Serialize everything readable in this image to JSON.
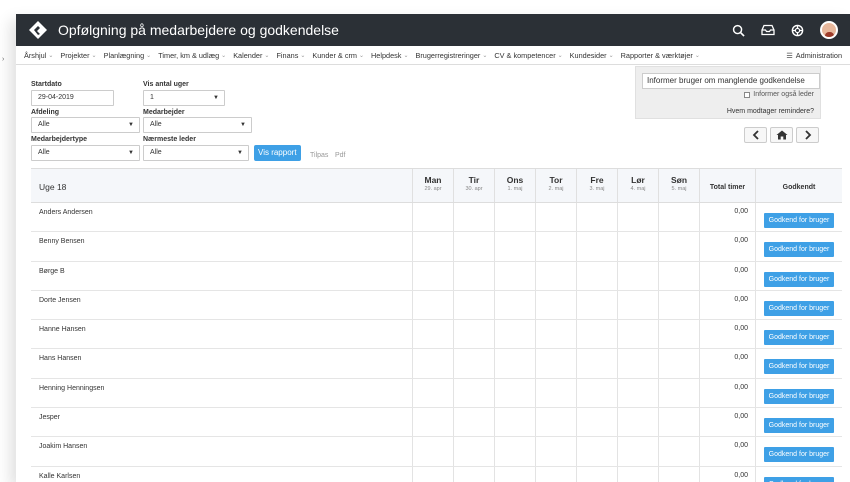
{
  "header": {
    "title": "Opfølgning på medarbejdere og godkendelse"
  },
  "nav": {
    "items": [
      {
        "label": "Årshjul"
      },
      {
        "label": "Projekter"
      },
      {
        "label": "Planlægning"
      },
      {
        "label": "Timer, km & udlæg"
      },
      {
        "label": "Kalender"
      },
      {
        "label": "Finans"
      },
      {
        "label": "Kunder & crm"
      },
      {
        "label": "Helpdesk"
      },
      {
        "label": "Brugerregistreringer"
      },
      {
        "label": "CV & kompetencer"
      },
      {
        "label": "Kundesider"
      },
      {
        "label": "Rapporter & værktøjer"
      }
    ],
    "admin": "Administration"
  },
  "filters": {
    "startdato_label": "Startdato",
    "startdato_value": "29-04-2019",
    "vis_antal_uger_label": "Vis antal uger",
    "vis_antal_uger_value": "1",
    "afdeling_label": "Afdeling",
    "afdeling_value": "Alle",
    "medarbejder_label": "Medarbejder",
    "medarbejder_value": "Alle",
    "medarbejdertype_label": "Medarbejdertype",
    "medarbejdertype_value": "Alle",
    "naermeste_leder_label": "Nærmeste leder",
    "naermeste_leder_value": "Alle",
    "vis_rapport": "Vis rapport",
    "tilpas": "Tilpas",
    "pdf": "Pdf"
  },
  "reminder": {
    "button": "Informer bruger om manglende godkendelse",
    "also_leader": "Informer også leder",
    "who_link": "Hvem modtager remindere?"
  },
  "grid": {
    "week": "Uge 18",
    "days": [
      {
        "name": "Man",
        "date": "29. apr"
      },
      {
        "name": "Tir",
        "date": "30. apr"
      },
      {
        "name": "Ons",
        "date": "1. maj"
      },
      {
        "name": "Tor",
        "date": "2. maj"
      },
      {
        "name": "Fre",
        "date": "3. maj"
      },
      {
        "name": "Lør",
        "date": "4. maj"
      },
      {
        "name": "Søn",
        "date": "5. maj"
      }
    ],
    "total_header": "Total timer",
    "approved_header": "Godkendt",
    "approve_label": "Godkend for bruger",
    "rows": [
      {
        "name": "Anders Andersen",
        "total": "0,00"
      },
      {
        "name": "Benny Bensen",
        "total": "0,00"
      },
      {
        "name": "Børge B",
        "total": "0,00"
      },
      {
        "name": "Dorte Jensen",
        "total": "0,00"
      },
      {
        "name": "Hanne Hansen",
        "total": "0,00"
      },
      {
        "name": "Hans Hansen",
        "total": "0,00"
      },
      {
        "name": "Henning Henningsen",
        "total": "0,00"
      },
      {
        "name": "Jesper",
        "total": "0,00"
      },
      {
        "name": "Joakim Hansen",
        "total": "0,00"
      },
      {
        "name": "Kalle Karlsen",
        "total": "0,00"
      }
    ]
  },
  "colors": {
    "topbar": "#2b3036",
    "accent": "#3ea0e6"
  }
}
